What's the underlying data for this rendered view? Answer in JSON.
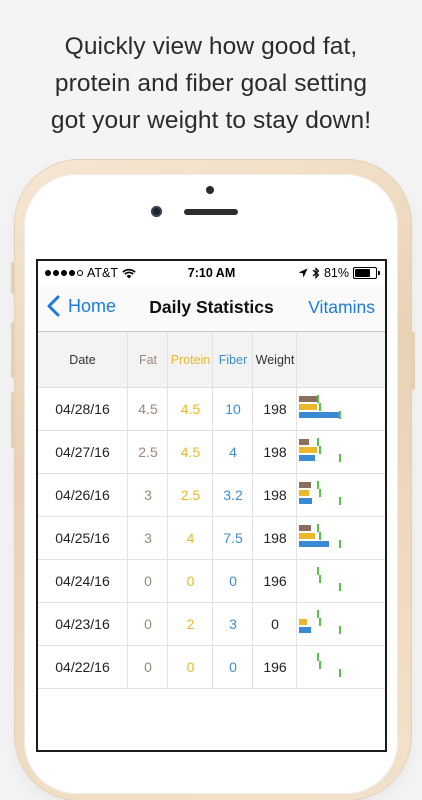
{
  "promo": {
    "line1": "Quickly view how good fat,",
    "line2": "protein and fiber goal setting",
    "line3": "got your weight to stay down!"
  },
  "status_bar": {
    "carrier": "AT&T",
    "time": "7:10 AM",
    "battery": "81%",
    "battery_level": 0.81,
    "signal_bars": 4
  },
  "nav": {
    "back_label": "Home",
    "title": "Daily Statistics",
    "right_label": "Vitamins"
  },
  "columns": {
    "date": "Date",
    "fat": "Fat",
    "protein": "Protein",
    "fiber": "Fiber",
    "weight": "Weight"
  },
  "colors": {
    "accent": "#1a7cd8",
    "fat": "#8b6f5c",
    "protein": "#e9b92b",
    "fiber": "#3a8ad1",
    "goal": "#5ac14e"
  },
  "rows": [
    {
      "date": "04/28/16",
      "fat": "4.5",
      "protein": "4.5",
      "fiber": "10",
      "weight": "198"
    },
    {
      "date": "04/27/16",
      "fat": "2.5",
      "protein": "4.5",
      "fiber": "4",
      "weight": "198"
    },
    {
      "date": "04/26/16",
      "fat": "3",
      "protein": "2.5",
      "fiber": "3.2",
      "weight": "198"
    },
    {
      "date": "04/25/16",
      "fat": "3",
      "protein": "4",
      "fiber": "7.5",
      "weight": "198"
    },
    {
      "date": "04/24/16",
      "fat": "0",
      "protein": "0",
      "fiber": "0",
      "weight": "196"
    },
    {
      "date": "04/23/16",
      "fat": "0",
      "protein": "2",
      "fiber": "3",
      "weight": "0"
    },
    {
      "date": "04/22/16",
      "fat": "0",
      "protein": "0",
      "fiber": "0",
      "weight": "196"
    }
  ]
}
